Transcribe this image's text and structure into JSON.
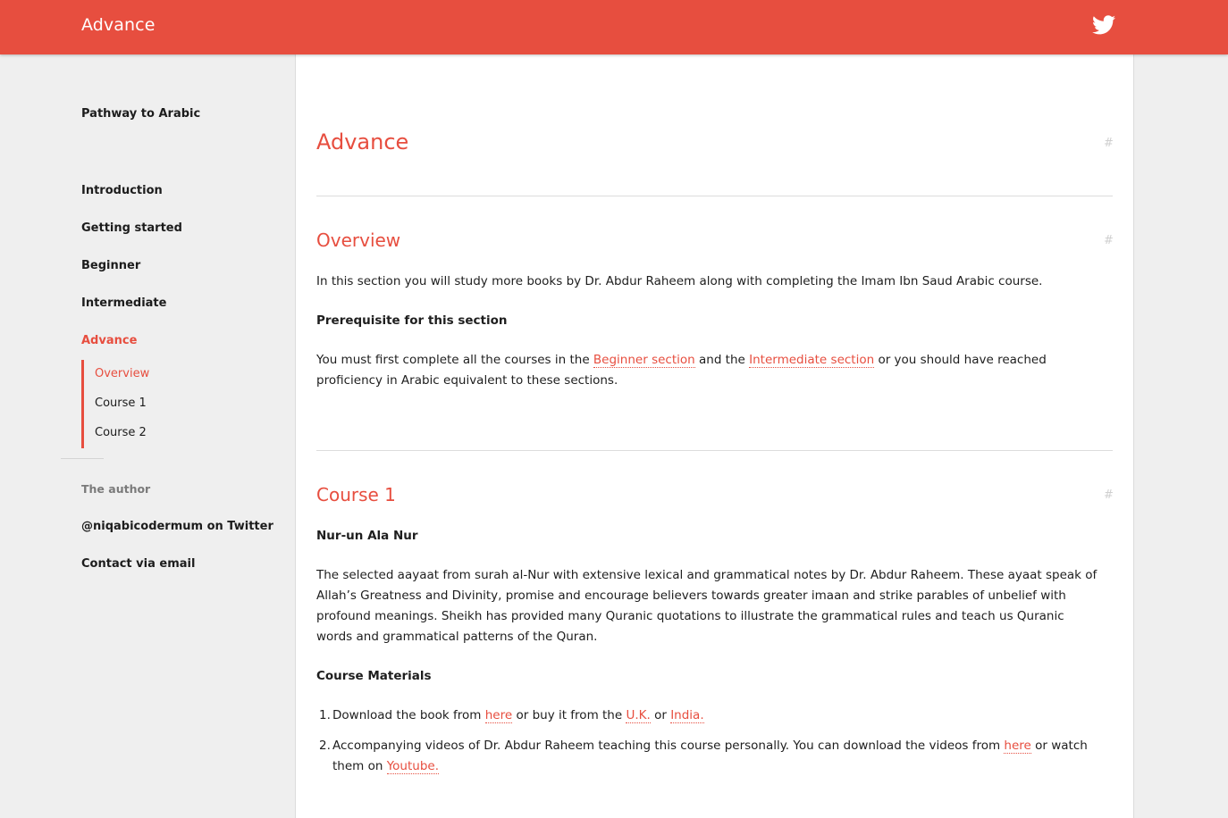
{
  "header": {
    "brand": "Advance",
    "twitter_icon": "twitter-bird-icon",
    "accent_color": "#e74e3f"
  },
  "sidebar": {
    "title": "Pathway to Arabic",
    "nav": [
      {
        "label": "Introduction"
      },
      {
        "label": "Getting started"
      },
      {
        "label": "Beginner"
      },
      {
        "label": "Intermediate"
      },
      {
        "label": "Advance",
        "active": true
      }
    ],
    "subnav": [
      {
        "label": "Overview",
        "active": true
      },
      {
        "label": "Course 1"
      },
      {
        "label": "Course 2"
      }
    ],
    "author_label": "The author",
    "twitter_link": "@niqabicodermum on Twitter",
    "email_link": "Contact via email"
  },
  "main": {
    "anchor_symbol": "#",
    "page_title": "Advance",
    "overview": {
      "heading": "Overview",
      "intro": "In this section you will study more books by Dr. Abdur Raheem along with completing the Imam Ibn Saud Arabic course.",
      "prereq_heading": "Prerequisite for this section",
      "prereq_text_1": "You must first complete all the courses in the ",
      "beginner_link": "Beginner section",
      "prereq_text_2": " and the ",
      "intermediate_link": "Intermediate section",
      "prereq_text_3": " or you should have reached proficiency in Arabic equivalent to these sections."
    },
    "course1": {
      "heading": "Course 1",
      "book_title": "Nur-un Ala Nur",
      "description": "The selected aayaat from surah al-Nur with extensive lexical and grammatical notes by Dr. Abdur Raheem. These ayaat speak of Allah’s Greatness and Divinity, promise and encourage believers towards greater imaan and strike parables of unbelief with profound meanings. Sheikh has provided many Quranic quotations to illustrate the grammatical rules and teach us Quranic words and grammatical patterns of the Quran.",
      "materials_heading": "Course Materials",
      "item1": {
        "num": "1.",
        "t1": "Download the book from ",
        "here": "here",
        "t2": " or buy it from the ",
        "uk": "U.K.",
        "t3": " or ",
        "india": "India."
      },
      "item2": {
        "num": "2.",
        "t1": "Accompanying videos of Dr. Abdur Raheem teaching this course personally. You can download the videos from ",
        "here": "here",
        "t2": " or watch them on ",
        "youtube": "Youtube."
      }
    }
  }
}
